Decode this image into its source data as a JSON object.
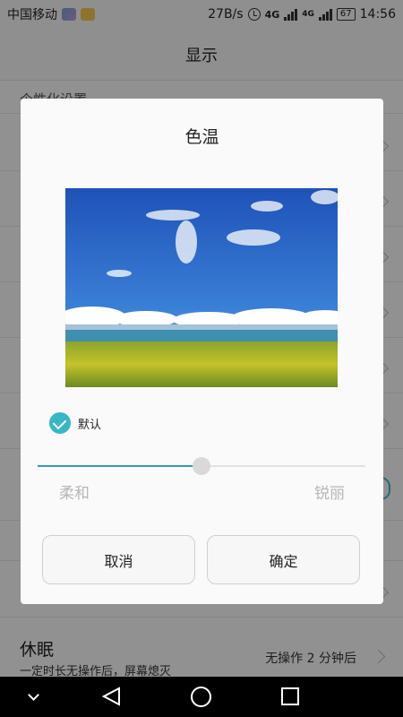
{
  "status_bar": {
    "carrier": "中国移动",
    "speed": "27B/s",
    "network_1": "4G",
    "network_2": "4G",
    "battery": "67",
    "time": "14:56"
  },
  "header": {
    "title": "显示"
  },
  "settings": {
    "section_title": "个性化设置",
    "sleep": {
      "title": "休眠",
      "subtitle": "一定时长无操作后，屏幕熄灭",
      "value": "无操作 2 分钟后"
    }
  },
  "dialog": {
    "title": "色温",
    "default_label": "默认",
    "default_checked": true,
    "slider": {
      "value": 0.5,
      "min_label": "柔和",
      "max_label": "锐丽"
    },
    "cancel_label": "取消",
    "ok_label": "确定"
  },
  "colors": {
    "accent": "#37b6c6",
    "scrim": "rgba(0,0,0,0.42)"
  }
}
